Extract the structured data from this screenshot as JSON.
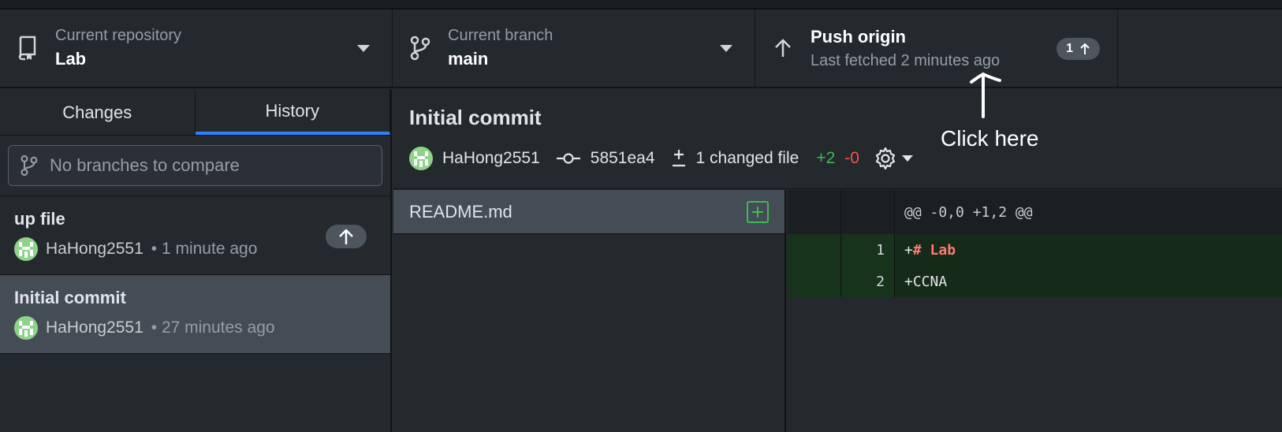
{
  "toolbar": {
    "repo": {
      "label": "Current repository",
      "value": "Lab",
      "icon": "repo-icon"
    },
    "branch": {
      "label": "Current branch",
      "value": "main",
      "icon": "git-branch-icon"
    },
    "push": {
      "title": "Push origin",
      "subtitle": "Last fetched 2 minutes ago",
      "count": "1",
      "icon": "arrow-up-icon"
    }
  },
  "sidebar": {
    "tabs": [
      {
        "label": "Changes"
      },
      {
        "label": "History"
      }
    ],
    "compare_placeholder": "No branches to compare",
    "commits": [
      {
        "title": "up file",
        "author": "HaHong2551",
        "time": "• 1 minute ago"
      },
      {
        "title": "Initial commit",
        "author": "HaHong2551",
        "time": "• 27 minutes ago"
      }
    ]
  },
  "commit": {
    "title": "Initial commit",
    "author": "HaHong2551",
    "sha": "5851ea4",
    "changed": "1 changed file",
    "additions": "+2",
    "deletions": "-0"
  },
  "files": [
    {
      "name": "README.md"
    }
  ],
  "diff": {
    "hunk": "@@ -0,0 +1,2 @@",
    "lines": [
      {
        "num": "1",
        "prefix": "+",
        "text": "# Lab"
      },
      {
        "num": "2",
        "prefix": "+",
        "text": "CCNA"
      }
    ]
  },
  "annotation": {
    "text": "Click here"
  },
  "colors": {
    "accent": "#2f81f7",
    "added": "#3fb950",
    "deleted": "#f85149"
  }
}
